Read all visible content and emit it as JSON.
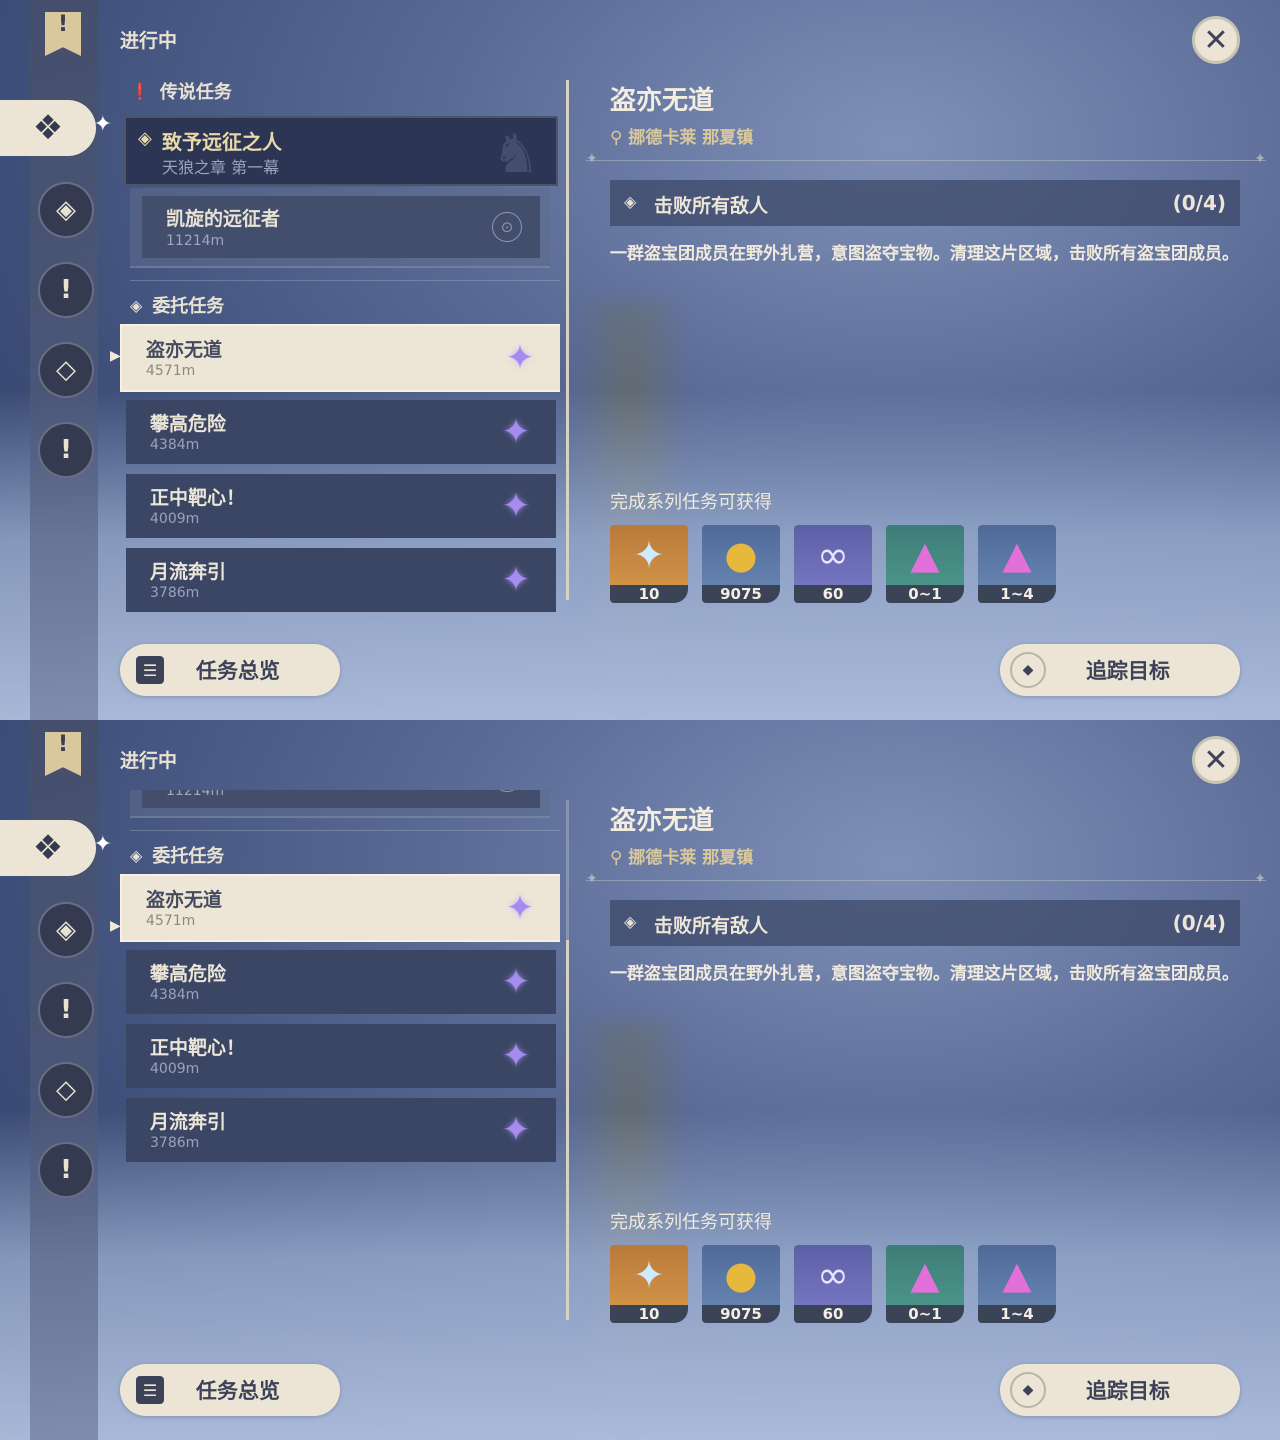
{
  "status_title": "进行中",
  "legend_category": "传说任务",
  "legend_quest": {
    "title": "致予远征之人",
    "subtitle": "天狼之章 第一幕"
  },
  "legend_subquest": {
    "title": "凯旋的远征者",
    "distance": "11214m"
  },
  "commission_category": "委托任务",
  "commissions": [
    {
      "title": "盗亦无道",
      "distance": "4571m",
      "selected": true
    },
    {
      "title": "攀高危险",
      "distance": "4384m",
      "selected": false
    },
    {
      "title": "正中靶心！",
      "distance": "4009m",
      "selected": false
    },
    {
      "title": "月流奔引",
      "distance": "3786m",
      "selected": false
    }
  ],
  "detail": {
    "title": "盗亦无道",
    "location": "挪德卡莱 那夏镇",
    "objective": "击败所有敌人",
    "objective_count": "(0/4)",
    "description": "一群盗宝团成员在野外扎营，意图盗夺宝物。清理这片区域，击败所有盗宝团成员。",
    "rewards_title": "完成系列任务可获得",
    "rewards": [
      {
        "icon": "primogem-icon",
        "amount": "10"
      },
      {
        "icon": "mora-icon",
        "amount": "9075"
      },
      {
        "icon": "adventure-exp-icon",
        "amount": "60"
      },
      {
        "icon": "crystal-chunk-icon",
        "amount": "0~1"
      },
      {
        "icon": "crystal-cluster-icon",
        "amount": "1~4"
      }
    ]
  },
  "buttons": {
    "overview": "任务总览",
    "track": "追踪目标"
  },
  "colors": {
    "accent_gold": "#d9c89b",
    "selected_bg": "#ede6d6",
    "row_bg": "#3b4665",
    "star": "#a68cf0"
  }
}
